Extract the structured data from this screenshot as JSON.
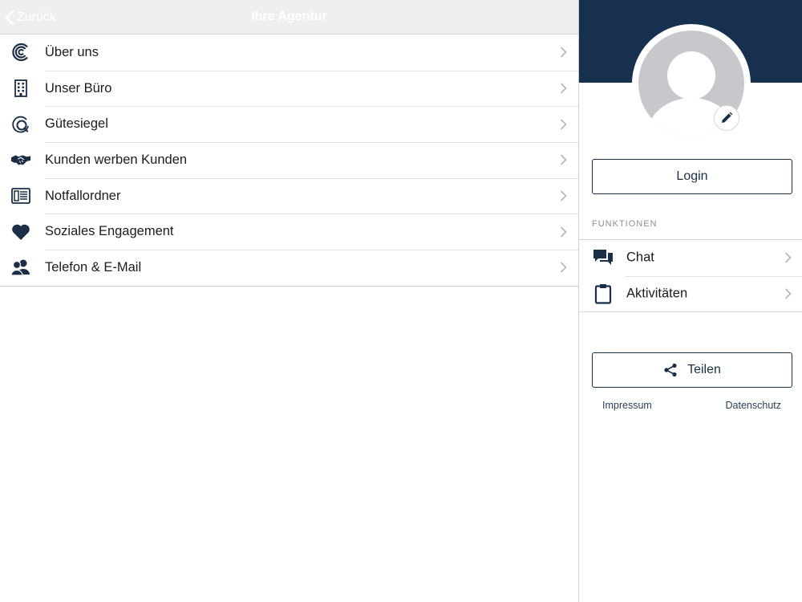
{
  "navbar": {
    "back_label": "Zurück",
    "title": "Ihre Agentur"
  },
  "menu": {
    "items": [
      {
        "label": "Über uns",
        "icon": "logo-c-icon"
      },
      {
        "label": "Unser Büro",
        "icon": "building-icon"
      },
      {
        "label": "Gütesiegel",
        "icon": "quality-seal-icon"
      },
      {
        "label": "Kunden werben Kunden",
        "icon": "handshake-icon"
      },
      {
        "label": "Notfallordner",
        "icon": "folder-document-icon"
      },
      {
        "label": "Soziales Engagement",
        "icon": "heart-icon"
      },
      {
        "label": "Telefon & E-Mail",
        "icon": "contacts-icon"
      }
    ]
  },
  "profile": {
    "login_label": "Login",
    "functions_heading": "FUNKTIONEN",
    "functions": [
      {
        "label": "Chat",
        "icon": "chat-icon"
      },
      {
        "label": "Aktivitäten",
        "icon": "clipboard-icon"
      }
    ],
    "share_label": "Teilen",
    "impressum_label": "Impressum",
    "datenschutz_label": "Datenschutz"
  },
  "colors": {
    "brand_navy": "#17304f",
    "icon_navy": "#1b2e45",
    "navbar_bg": "#efeff0"
  }
}
